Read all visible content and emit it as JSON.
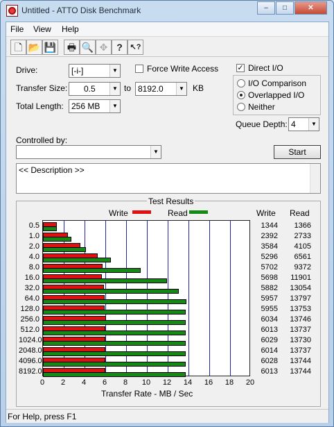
{
  "window": {
    "title": "Untitled - ATTO Disk Benchmark",
    "btn_min": "–",
    "btn_max": "□",
    "btn_close": "✕"
  },
  "menu": [
    "File",
    "View",
    "Help"
  ],
  "toolbar": {
    "icons": [
      "new-icon",
      "open-icon",
      "save-icon",
      "print-icon",
      "print-preview-icon",
      "move-icon",
      "help-icon",
      "context-help-icon"
    ],
    "glyphs": [
      "🗋",
      "📂",
      "💾",
      "🖶",
      "🔍",
      "✥",
      "?",
      "↖?"
    ]
  },
  "settings": {
    "drive_label": "Drive:",
    "drive_value": "[-i-]",
    "force_write_label": "Force Write Access",
    "force_write_checked": false,
    "direct_io_label": "Direct I/O",
    "direct_io_checked": true,
    "transfer_size_label": "Transfer Size:",
    "transfer_from": "0.5",
    "to_label": "to",
    "transfer_to": "8192.0",
    "kb_label": "KB",
    "total_length_label": "Total Length:",
    "total_length": "256 MB",
    "io_options": [
      {
        "label": "I/O Comparison",
        "selected": false
      },
      {
        "label": "Overlapped I/O",
        "selected": true
      },
      {
        "label": "Neither",
        "selected": false
      }
    ],
    "queue_depth_label": "Queue Depth:",
    "queue_depth": "4",
    "controlled_by_label": "Controlled by:",
    "controlled_by_value": "",
    "start_label": "Start",
    "description": "<< Description >>"
  },
  "results": {
    "title": "Test Results",
    "legend_write": "Write",
    "legend_read": "Read",
    "col_write": "Write",
    "col_read": "Read",
    "colors": {
      "write": "#e01010",
      "read": "#148a14",
      "grid": "#2222aa"
    }
  },
  "chart_data": {
    "type": "bar",
    "orientation": "horizontal",
    "categories": [
      "0.5",
      "1.0",
      "2.0",
      "4.0",
      "8.0",
      "16.0",
      "32.0",
      "64.0",
      "128.0",
      "256.0",
      "512.0",
      "1024.0",
      "2048.0",
      "4096.0",
      "8192.0"
    ],
    "series": [
      {
        "name": "Write",
        "values": [
          1344,
          2392,
          3584,
          5296,
          5702,
          5698,
          5882,
          5957,
          5955,
          6034,
          6013,
          6029,
          6014,
          6028,
          6013
        ]
      },
      {
        "name": "Read",
        "values": [
          1366,
          2733,
          4105,
          6561,
          9372,
          11901,
          13054,
          13797,
          13753,
          13746,
          13737,
          13730,
          13737,
          13744,
          13744
        ]
      }
    ],
    "xlabel": "Transfer Rate - MB / Sec",
    "xticks": [
      "0",
      "2",
      "4",
      "6",
      "8",
      "10",
      "12",
      "14",
      "16",
      "18",
      "20"
    ],
    "xlim": [
      0,
      20
    ],
    "grid": true,
    "legend_position": "top"
  },
  "statusbar": {
    "text": "For Help, press F1"
  }
}
